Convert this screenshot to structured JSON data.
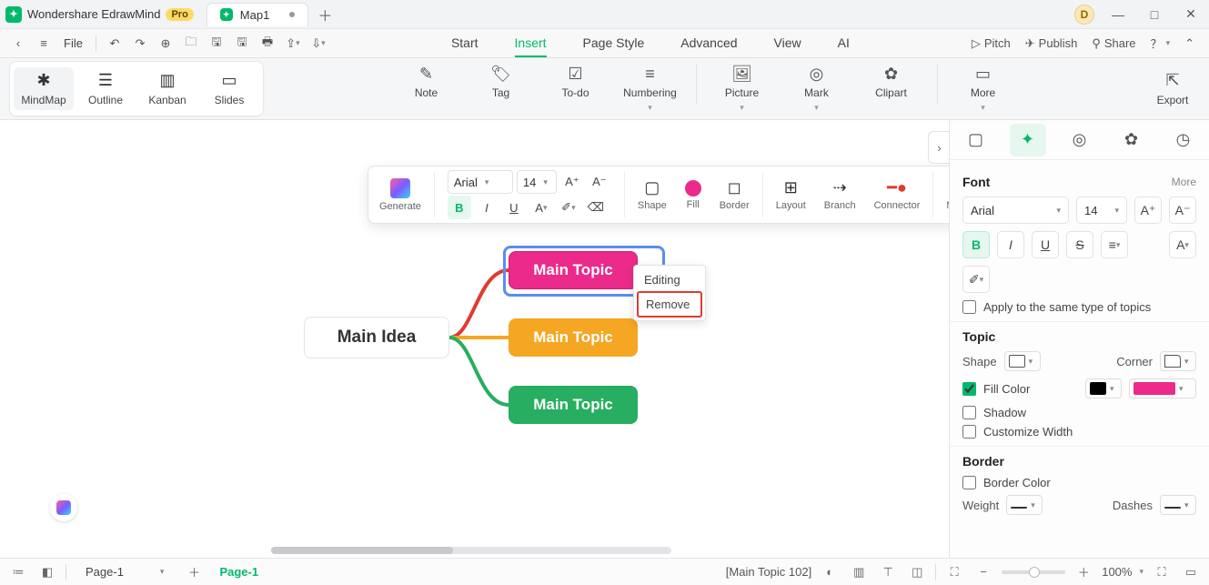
{
  "titlebar": {
    "app_name": "Wondershare EdrawMind",
    "pro": "Pro",
    "tab_name": "Map1",
    "avatar_letter": "D"
  },
  "menubar": {
    "file": "File",
    "tabs": [
      "Start",
      "Insert",
      "Page Style",
      "Advanced",
      "View",
      "AI"
    ],
    "active_index": 1,
    "right": {
      "pitch": "Pitch",
      "publish": "Publish",
      "share": "Share"
    }
  },
  "view_modes": [
    "MindMap",
    "Outline",
    "Kanban",
    "Slides"
  ],
  "ribbon_tools": [
    "Note",
    "Tag",
    "To-do",
    "Numbering",
    "Picture",
    "Mark",
    "Clipart",
    "More"
  ],
  "export": "Export",
  "float": {
    "generate": "Generate",
    "font": "Arial",
    "size": "14",
    "labels": {
      "shape": "Shape",
      "fill": "Fill",
      "border": "Border",
      "layout": "Layout",
      "branch": "Branch",
      "connector": "Connector",
      "more": "More"
    }
  },
  "mindmap": {
    "central": "Main Idea",
    "topic1": "Main Topic",
    "topic2": "Main Topic",
    "topic3": "Main Topic"
  },
  "context_menu": {
    "editing": "Editing",
    "remove": "Remove"
  },
  "rpanel": {
    "font": {
      "header": "Font",
      "more": "More",
      "family": "Arial",
      "size": "14",
      "apply": "Apply to the same type of topics"
    },
    "topic": {
      "header": "Topic",
      "shape": "Shape",
      "corner": "Corner",
      "fill": "Fill Color",
      "shadow": "Shadow",
      "custom": "Customize Width"
    },
    "border": {
      "header": "Border",
      "color": "Border Color",
      "weight": "Weight",
      "dashes": "Dashes"
    }
  },
  "status": {
    "page_sel": "Page-1",
    "page_tab": "Page-1",
    "selection": "[Main Topic 102]",
    "zoom": "100%"
  }
}
